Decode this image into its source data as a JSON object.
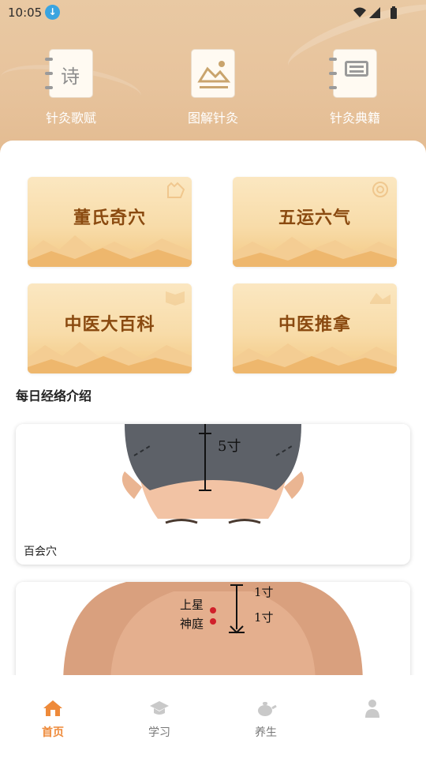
{
  "status": {
    "time": "10:05"
  },
  "top_entries": [
    {
      "label": "针灸歌赋",
      "icon": "poem-notebook-icon",
      "glyph": "诗"
    },
    {
      "label": "图解针灸",
      "icon": "picture-icon"
    },
    {
      "label": "针灸典籍",
      "icon": "book-icon"
    }
  ],
  "tiles": [
    {
      "label": "董氏奇穴"
    },
    {
      "label": "五运六气"
    },
    {
      "label": "中医大百科"
    },
    {
      "label": "中医推拿"
    }
  ],
  "section": {
    "title": "每日经络介绍"
  },
  "cards": [
    {
      "caption": "百会穴",
      "figure_text": "5寸"
    },
    {
      "caption": "",
      "figure_labels": [
        "上星",
        "神庭"
      ],
      "figure_measures": [
        "1寸",
        "1寸"
      ]
    }
  ],
  "nav": [
    {
      "label": "首页",
      "icon": "home-icon",
      "active": true
    },
    {
      "label": "学习",
      "icon": "graduation-cap-icon",
      "active": false
    },
    {
      "label": "养生",
      "icon": "teapot-icon",
      "active": false
    },
    {
      "label": "",
      "icon": "person-icon",
      "active": false
    }
  ],
  "colors": {
    "accent": "#ee8a3a",
    "tile_text": "#8a4a10",
    "header": "#e7c39c"
  }
}
